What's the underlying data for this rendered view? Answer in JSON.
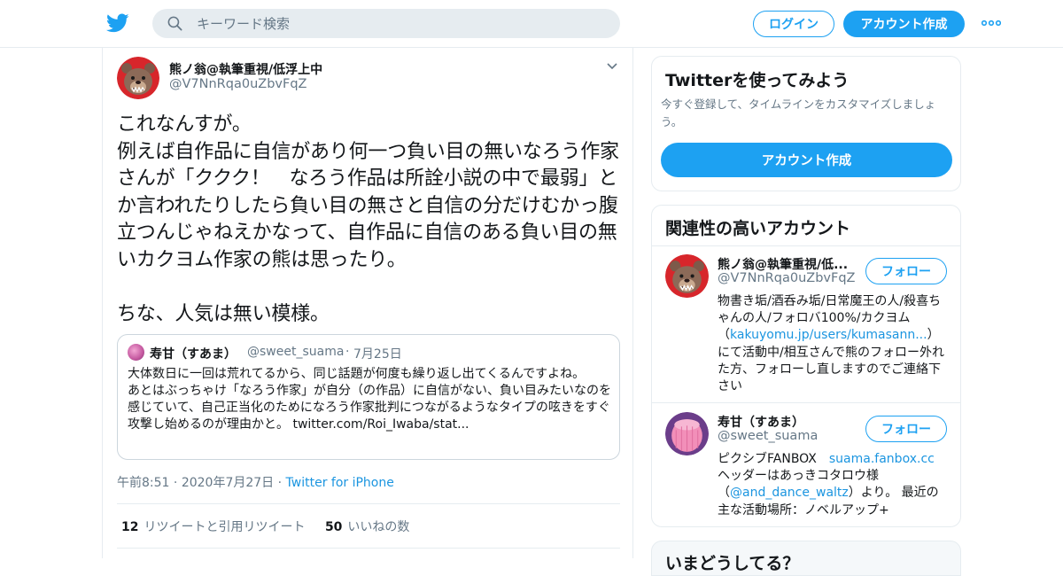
{
  "header": {
    "search_placeholder": "キーワード検索",
    "login_label": "ログイン",
    "signup_label": "アカウント作成"
  },
  "tweet": {
    "author_name": "熊ノ翁@執筆重視/低浮上中",
    "author_handle": "@V7NnRqa0uZbvFqZ",
    "text": "これなんすが。\n例えば自作品に自信があり何一つ負い目の無いなろう作家さんが「ククク！　なろう作品は所詮小説の中で最弱」とか言われたりしたら負い目の無さと自信の分だけむかっ腹立つんじゃねえかなって、自作品に自信のある負い目の無いカクヨム作家の熊は思ったり。\n\nちな、人気は無い模様。",
    "quote": {
      "name": "寿甘（すあま）",
      "handle": "@sweet_suama",
      "separator": "·",
      "date": "7月25日",
      "text": "大体数日に一回は荒れてるから、同じ話題が何度も繰り返し出てくるんですよね。\nあとはぶっちゃけ「なろう作家」が自分（の作品）に自信がない、負い目みたいなのを感じていて、自己正当化のためになろう作家批判につながるようなタイプの呟きをすぐ攻撃し始めるのが理由かと。 twitter.com/Roi_Iwaba/stat..."
    },
    "time": "午前8:51",
    "date": "2020年7月27日",
    "separator": "·",
    "source": "Twitter for iPhone",
    "retweet_count": "12",
    "retweet_label": "リツイートと引用リツイート",
    "like_count": "50",
    "like_label": "いいねの数"
  },
  "sidebar": {
    "try_card": {
      "title": "Twitterを使ってみよう",
      "subtitle": "今すぐ登録して、タイムラインをカスタマイズしましょう。",
      "button": "アカウント作成"
    },
    "related": {
      "title": "関連性の高いアカウント",
      "follow_label": "フォロー",
      "accounts": [
        {
          "name": "熊ノ翁@執筆重視/低...",
          "handle": "@V7NnRqa0uZbvFqZ",
          "bio_before": "物書き垢/酒呑み垢/日常魔王の人/殺喜ちゃんの人/フォロバ100%/カクヨム（",
          "bio_link": "kakuyomu.jp/users/kumasann...",
          "bio_after": "）にて活動中/相互さんで熊のフォロー外れた方、フォローし直しますのでご連絡下さい"
        },
        {
          "name": "寿甘（すあま）",
          "handle": "@sweet_suama",
          "bio_before": "ピクシブFANBOX　",
          "bio_link": "suama.fanbox.cc",
          "bio_middle": "ヘッダーはあっきコタロウ様（",
          "bio_link2": "@and_dance_waltz",
          "bio_after": "）より。 最近の主な活動場所：ノベルアップ+"
        }
      ]
    },
    "bottom_card_title": "いまどうしてる？"
  },
  "colors": {
    "accent": "#1da1f2",
    "link": "#1b95e0",
    "border": "#e6ecf0",
    "muted": "#657786"
  }
}
